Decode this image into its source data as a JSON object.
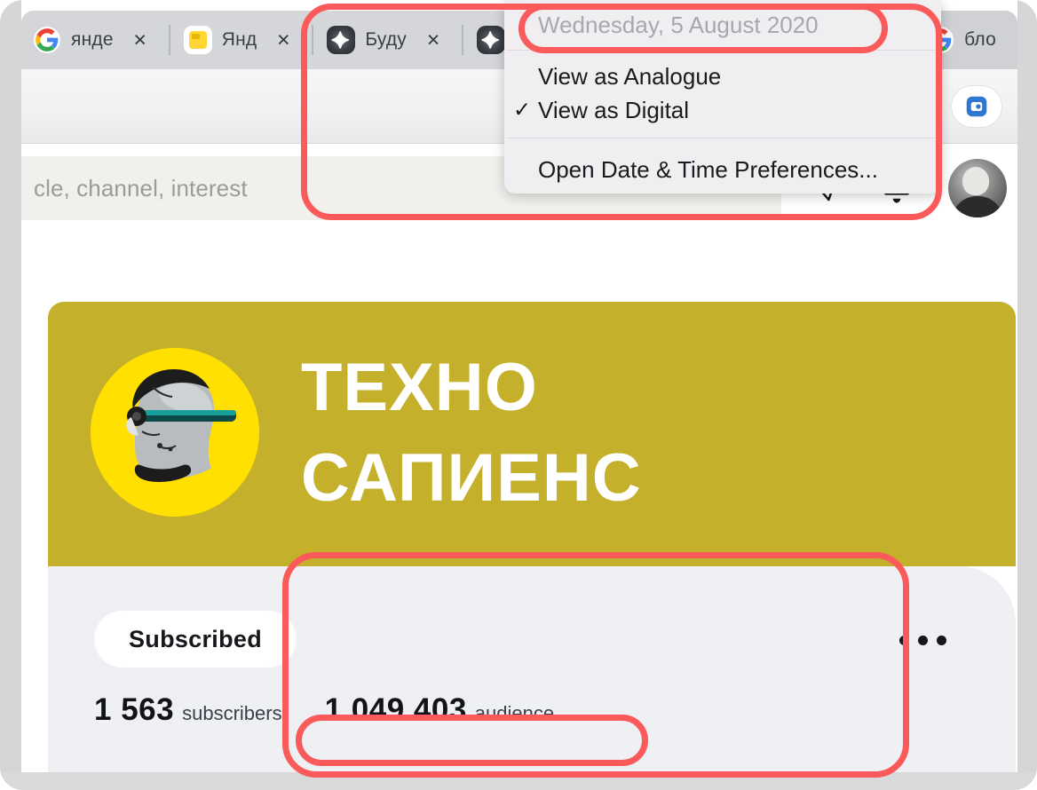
{
  "browser": {
    "tabs": [
      {
        "title": "янде",
        "favicon": "google-icon",
        "close_label": "×"
      },
      {
        "title": "Янд",
        "favicon": "yandex-zen-icon",
        "close_label": "×"
      },
      {
        "title": "Буду",
        "favicon": "sparkle-icon",
        "close_label": "×"
      },
      {
        "title": "",
        "favicon": "sparkle-icon",
        "close_label": ""
      },
      {
        "title": "бло",
        "favicon": "google-icon",
        "close_label": ""
      }
    ],
    "toolbar": {
      "bookmark_icon": "star-icon",
      "extension_icon": "extension-icon"
    }
  },
  "datetime_menu": {
    "date": "Wednesday, 5 August 2020",
    "items": [
      {
        "label": "View as Analogue",
        "checked": false
      },
      {
        "label": "View as Digital",
        "checked": true,
        "check_glyph": "✓"
      }
    ],
    "preferences_label": "Open Date & Time Preferences..."
  },
  "site": {
    "search": {
      "placeholder": "cle, channel, interest",
      "icon": "search-icon"
    },
    "actions": [
      {
        "name": "messages-icon",
        "badge": true
      },
      {
        "name": "notifications-bell-icon",
        "badge": true
      }
    ],
    "avatar_name": "user-avatar"
  },
  "channel": {
    "banner": {
      "title": "ТЕХНО\nСАПИЕНС",
      "background_color": "#c5b02c",
      "avatar_circle_color": "#ffe000"
    },
    "subscribe_label": "Subscribed",
    "stats": [
      {
        "value": "1 563",
        "label": "subscribers"
      },
      {
        "value": "1 049 403",
        "label": "audience"
      }
    ],
    "more_menu": "more-options-icon"
  },
  "annotations": {
    "color": "#fa5a5a",
    "shapes": [
      "date-highlight",
      "menu-and-tabs-region",
      "stats-region",
      "audience-highlight"
    ]
  }
}
